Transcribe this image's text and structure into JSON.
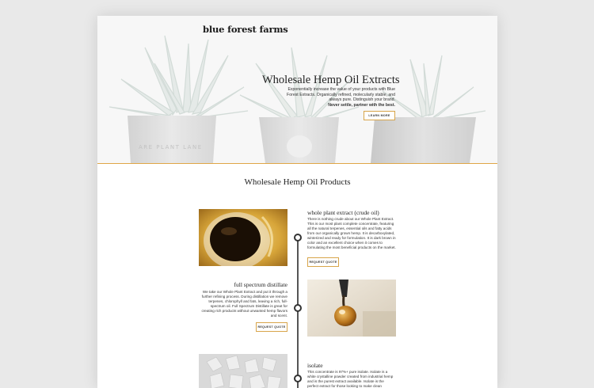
{
  "brand": "blue forest farms",
  "hero": {
    "title": "Wholesale Hemp Oil Extracts",
    "description": "Exponentially increase the value of your products with Blue Forest Extracts. Organically refined, molecularly stable, and always pure. Distinguish your brand.",
    "tagline": "Never settle, partner with the best.",
    "button": "LEARN MORE",
    "pot_text": "ARE PLANT LANE"
  },
  "products_section": {
    "title": "Wholesale Hemp Oil Products",
    "items": [
      {
        "title": "whole plant extract (crude oil)",
        "description": "There is nothing crude about our Whole Plant Extract. This is our most plant complete concentrate, featuring all the natural terpenes, essential oils and fatty acids from our organically grown hemp. It is decarboxylated, winterized and ready for formulation. It is dark brown in color and an excellent choice when it comes to formulating the most beneficial products on the market.",
        "button": "REQUEST QUOTE"
      },
      {
        "title": "full spectrum distillate",
        "description": "We take our Whole Plant Extract and put it through a further refining process. During distillation we remove terpenes, chlorophyll and fats, leaving a rich, full-spectrum oil. Full Spectrum Distillate is great for creating rich products without unwanted hemp flavors and scent.",
        "button": "REQUEST QUOTE"
      },
      {
        "title": "isolate",
        "description": "This concentrate is 97%+ pure isolate. Isolate is a white crystalline powder created from industrial hemp and is the purest extract available. Isolate is the perfect extract for those looking to make clean",
        "button": ""
      }
    ]
  },
  "colors": {
    "accent": "#e0a646",
    "background": "#e9e9e9",
    "page": "#ffffff",
    "text": "#222222"
  }
}
